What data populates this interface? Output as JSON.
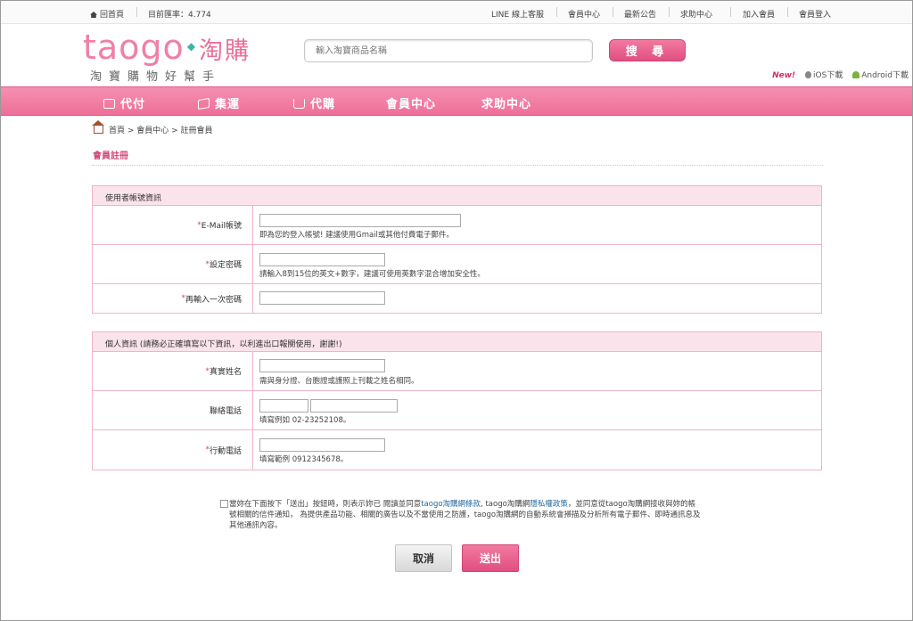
{
  "topbar": {
    "home": "回首頁",
    "rate": "目前匯率：4.774",
    "links": [
      "LINE 線上客服",
      "會員中心",
      "最新公告",
      "求助中心",
      "加入會員",
      "會員登入"
    ]
  },
  "header": {
    "logo_en": "taogo",
    "logo_cn": "淘購",
    "tagline": "淘寶購物好幫手",
    "search_placeholder": "輸入淘寶商品名稱",
    "search_button": "搜 尋",
    "new_label": "New!",
    "ios": "iOS下載",
    "android": "Android下載"
  },
  "nav": [
    "代付",
    "集運",
    "代購",
    "會員中心",
    "求助中心"
  ],
  "breadcrumb": "首頁 > 會員中心 > 註冊會員",
  "page_title": "會員註冊",
  "account_section": {
    "title": "使用者帳號資訊",
    "email_label": "E-Mail帳號",
    "email_hint": "即為您的登入帳號! 建議使用Gmail或其他付費電子郵件。",
    "password_label": "設定密碼",
    "password_hint": "請輸入8到15位的英文+數字，建議可使用英數字混合增加安全性。",
    "confirm_label": "再輸入一次密碼"
  },
  "personal_section": {
    "title": "個人資訊 (請務必正確填寫以下資訊，以利進出口報關使用，謝謝!)",
    "name_label": "真實姓名",
    "name_hint": "需與身分證、台胞證或護照上刊載之姓名相同。",
    "phone_label": "聯絡電話",
    "phone_hint": "填寫例如 02-23252108。",
    "mobile_label": "行動電話",
    "mobile_hint": "填寫範例 0912345678。"
  },
  "agreement": {
    "p1": "當妳在下面按下「送出」按鈕時，則表示妳已 閱讀並同意",
    "terms": "taogo淘購網條款",
    "p2": ", taogo淘購網",
    "privacy": "隱私權政策",
    "p3": "，並同意從taogo淘購網接收與妳的帳號相關的信件通知， 為提供產品功能、相關的廣告以及不當使用之防護，taogo淘購網的自動系統會掃描及分析所有電子郵件、即時通訊息及其他通訊內容。"
  },
  "buttons": {
    "cancel": "取消",
    "submit": "送出"
  }
}
